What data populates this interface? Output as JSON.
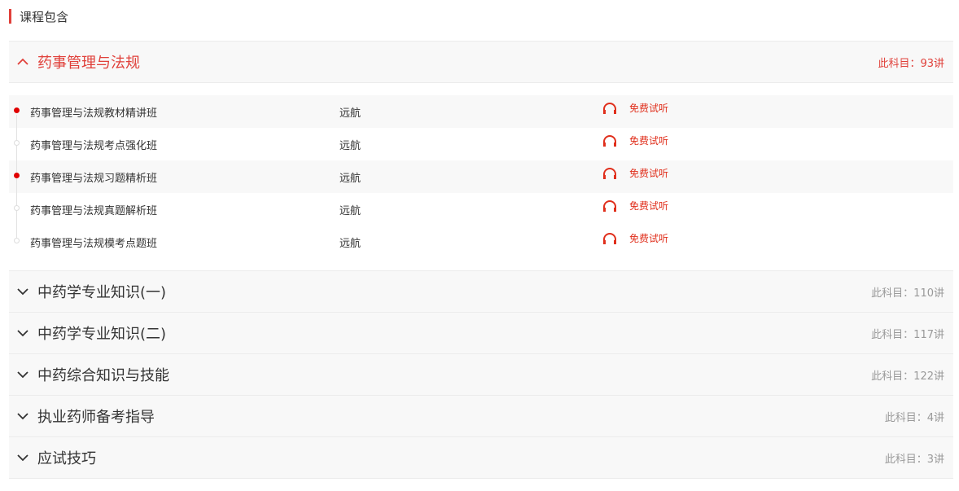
{
  "section": {
    "title": "课程包含"
  },
  "subjects": [
    {
      "name": "药事管理与法规",
      "count": "此科目：93讲",
      "expanded": true,
      "lessons": [
        {
          "name": "药事管理与法规教材精讲班",
          "teacher": "远航",
          "action": "免费试听",
          "dot": "active"
        },
        {
          "name": "药事管理与法规考点强化班",
          "teacher": "远航",
          "action": "免费试听",
          "dot": "inactive"
        },
        {
          "name": "药事管理与法规习题精析班",
          "teacher": "远航",
          "action": "免费试听",
          "dot": "active"
        },
        {
          "name": "药事管理与法规真题解析班",
          "teacher": "远航",
          "action": "免费试听",
          "dot": "inactive"
        },
        {
          "name": "药事管理与法规模考点题班",
          "teacher": "远航",
          "action": "免费试听",
          "dot": "inactive"
        }
      ]
    },
    {
      "name": "中药学专业知识(一)",
      "count": "此科目：110讲",
      "expanded": false
    },
    {
      "name": "中药学专业知识(二)",
      "count": "此科目：117讲",
      "expanded": false
    },
    {
      "name": "中药综合知识与技能",
      "count": "此科目：122讲",
      "expanded": false
    },
    {
      "name": "执业药师备考指导",
      "count": "此科目：4讲",
      "expanded": false
    },
    {
      "name": "应试技巧",
      "count": "此科目：3讲",
      "expanded": false
    }
  ],
  "icons": {
    "expanded": "chevron-up-icon",
    "collapsed": "chevron-down-icon",
    "audition": "headphones-icon"
  },
  "colors": {
    "accent": "#e0403a",
    "audition": "#e02f1c",
    "active_dot": "#e00000",
    "muted": "#999999",
    "row_alt_bg": "#f8f8f8"
  }
}
